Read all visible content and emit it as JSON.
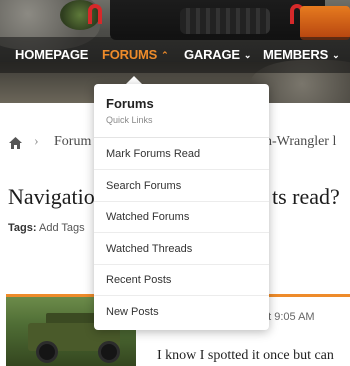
{
  "nav": {
    "items": [
      {
        "label": "HOMEPAGE",
        "chevron": false
      },
      {
        "label": "FORUMS",
        "chevron": true
      },
      {
        "label": "GARAGE",
        "chevron": true
      },
      {
        "label": "MEMBERS",
        "chevron": true
      }
    ],
    "active": "FORUMS",
    "accent_color": "#ee8b2a"
  },
  "breadcrumb": {
    "home_icon": "home-icon",
    "items": [
      "Forum",
      "on-Wrangler l"
    ]
  },
  "thread": {
    "title_left": "Navigatio",
    "title_right": "ts read?",
    "tags_label": "Tags:",
    "tags_action": "Add Tags"
  },
  "post": {
    "time": "at 9:05 AM",
    "text": "I know I spotted it once but can"
  },
  "menu": {
    "title": "Forums",
    "subtitle": "Quick Links",
    "items": [
      "Mark Forums Read",
      "Search Forums",
      "Watched Forums",
      "Watched Threads",
      "Recent Posts",
      "New Posts"
    ]
  }
}
